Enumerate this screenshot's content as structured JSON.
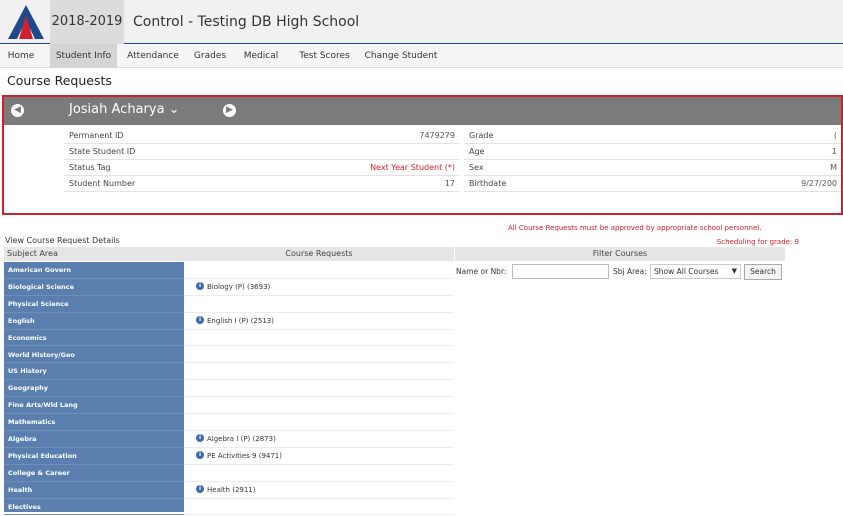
{
  "header": {
    "year": "2018-2019",
    "school": "Control - Testing DB High School"
  },
  "nav": {
    "items": [
      {
        "label": "Home"
      },
      {
        "label": "Student Info"
      },
      {
        "label": "Attendance"
      },
      {
        "label": "Grades"
      },
      {
        "label": "Medical"
      },
      {
        "label": "Test Scores"
      },
      {
        "label": "Change Student"
      }
    ],
    "active": "Student Info"
  },
  "page": {
    "title": "Course Requests"
  },
  "student": {
    "name": "Josiah Acharya ⌄",
    "left_fields": [
      {
        "label": "Permanent ID",
        "value": "7479279"
      },
      {
        "label": "State Student ID",
        "value": ""
      },
      {
        "label": "Status Tag",
        "value": "Next Year Student (*)"
      },
      {
        "label": "Student Number",
        "value": "17"
      }
    ],
    "right_fields": [
      {
        "label": "Grade",
        "value": "("
      },
      {
        "label": "Age",
        "value": "1"
      },
      {
        "label": "Sex",
        "value": "M"
      },
      {
        "label": "Birthdate",
        "value": "9/27/200"
      }
    ]
  },
  "notices": {
    "approval": "All Course Requests must be approved by appropriate school personnel.",
    "scheduling": "Scheduling for grade: 9"
  },
  "details": {
    "title": "View Course Request Details",
    "col_subject": "Subject Area",
    "col_requests": "Course Requests",
    "col_filter": "Filter Courses"
  },
  "rows": [
    {
      "subject": "American Govern",
      "request": ""
    },
    {
      "subject": "Biological Science",
      "request": "Biology (P) (3693)"
    },
    {
      "subject": "Physical Science",
      "request": ""
    },
    {
      "subject": "English",
      "request": "English I (P) (2513)"
    },
    {
      "subject": "Economics",
      "request": ""
    },
    {
      "subject": "World History/Geo",
      "request": ""
    },
    {
      "subject": "US History",
      "request": ""
    },
    {
      "subject": "Geography",
      "request": ""
    },
    {
      "subject": "Fine Arts/Wld Lang",
      "request": ""
    },
    {
      "subject": "Mathematics",
      "request": ""
    },
    {
      "subject": "Algebra",
      "request": "Algebra I (P) (2873)"
    },
    {
      "subject": "Physical Education",
      "request": "PE Activities 9 (9471)"
    },
    {
      "subject": "College & Career",
      "request": ""
    },
    {
      "subject": "Health",
      "request": "Health (2911)"
    },
    {
      "subject": "Electives",
      "request": ""
    }
  ],
  "filter": {
    "name_label": "Name or Nbr:",
    "name_value": "",
    "area_label": "Sbj Area:",
    "area_value": "Show All Courses",
    "search_label": "Search"
  },
  "colors": {
    "accent_red": "#d0202a",
    "subject_blue": "#5a7fae",
    "header_gray": "#7b7b7b",
    "brand_blue": "#1e4a8c"
  }
}
